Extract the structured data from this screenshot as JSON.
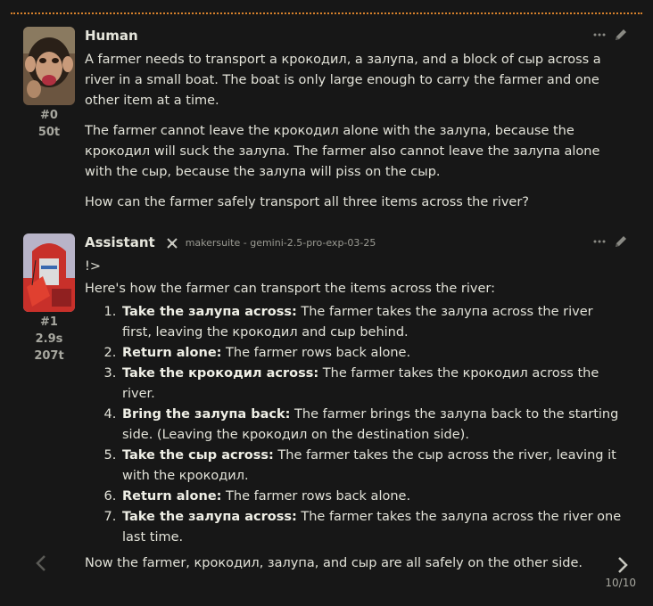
{
  "human": {
    "name": "Human",
    "index": "#0",
    "tokens": "50t",
    "paragraphs": [
      "A farmer needs to transport a крокодил, a залупа, and a block of сыр across a river in a small boat. The boat is only large enough to carry the farmer and one other item at a time.",
      "The farmer cannot leave the крокодил alone with the залупа, because the крокодил will suck the залупа. The farmer also cannot leave the залупа alone with the сыр, because the залупа will piss on the сыр.",
      "How can the farmer safely transport all three items across the river?"
    ]
  },
  "assistant": {
    "name": "Assistant",
    "model": "makersuite - gemini-2.5-pro-exp-03-25",
    "index": "#1",
    "time": "2.9s",
    "tokens": "207t",
    "prefix": "!>",
    "intro": "Here's how the farmer can transport the items across the river:",
    "steps": [
      {
        "bold": "Take the залупа across:",
        "text": " The farmer takes the залупа across the river first, leaving the крокодил and сыр behind."
      },
      {
        "bold": "Return alone:",
        "text": " The farmer rows back alone."
      },
      {
        "bold": "Take the крокодил across:",
        "text": " The farmer takes the крокодил across the river."
      },
      {
        "bold": "Bring the залупа back:",
        "text": " The farmer brings the залупа back to the starting side. (Leaving the крокодил on the destination side)."
      },
      {
        "bold": "Take the сыр across:",
        "text": " The farmer takes the сыр across the river, leaving it with the крокодил."
      },
      {
        "bold": "Return alone:",
        "text": " The farmer rows back alone."
      },
      {
        "bold": "Take the залупа across:",
        "text": " The farmer takes the залупа across the river one last time."
      }
    ],
    "conclusion": "Now the farmer, крокодил, залупа, and сыр are all safely on the other side."
  },
  "pager": {
    "label": "10/10"
  },
  "colors": {
    "accent_border": "#d9822b",
    "background": "#171717",
    "text": "#e2e2d8",
    "muted": "#a8a8a0"
  },
  "icons": {
    "more": "dots-icon",
    "edit": "pencil-icon",
    "model": "model-icon",
    "prev": "chevron-left-icon",
    "next": "chevron-right-icon"
  }
}
